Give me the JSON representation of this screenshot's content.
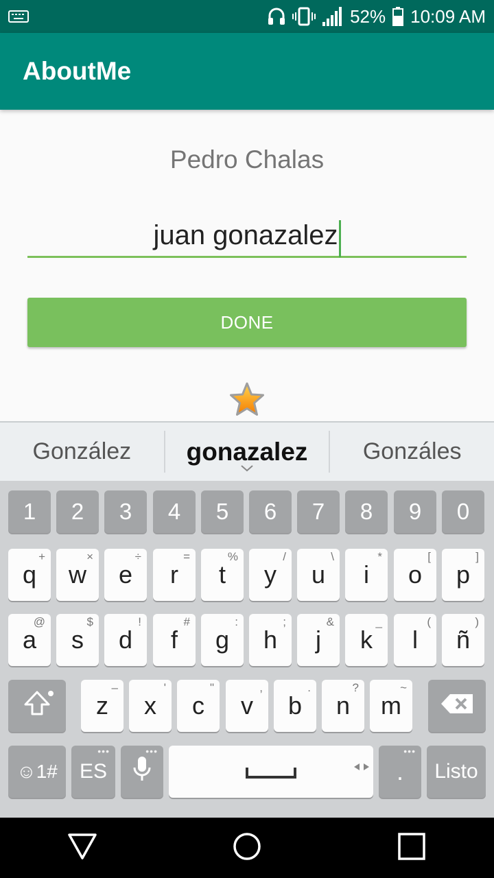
{
  "status_bar": {
    "battery": "52%",
    "time": "10:09 AM"
  },
  "app": {
    "title": "AboutMe"
  },
  "content": {
    "name_text": "Pedro Chalas",
    "nickname_input_value": "juan gonazalez",
    "done_label": "DONE"
  },
  "suggestions": [
    "González",
    "gonazalez",
    "Gonzáles"
  ],
  "keyboard": {
    "numbers": [
      "1",
      "2",
      "3",
      "4",
      "5",
      "6",
      "7",
      "8",
      "9",
      "0"
    ],
    "row1": [
      {
        "k": "q",
        "s": "+"
      },
      {
        "k": "w",
        "s": "×"
      },
      {
        "k": "e",
        "s": "÷"
      },
      {
        "k": "r",
        "s": "="
      },
      {
        "k": "t",
        "s": "%"
      },
      {
        "k": "y",
        "s": "/"
      },
      {
        "k": "u",
        "s": "\\"
      },
      {
        "k": "i",
        "s": "*"
      },
      {
        "k": "o",
        "s": "["
      },
      {
        "k": "p",
        "s": "]"
      }
    ],
    "row2": [
      {
        "k": "a",
        "s": "@"
      },
      {
        "k": "s",
        "s": "$"
      },
      {
        "k": "d",
        "s": "!"
      },
      {
        "k": "f",
        "s": "#"
      },
      {
        "k": "g",
        "s": ":"
      },
      {
        "k": "h",
        "s": ";"
      },
      {
        "k": "j",
        "s": "&"
      },
      {
        "k": "k",
        "s": "_"
      },
      {
        "k": "l",
        "s": "("
      },
      {
        "k": "ñ",
        "s": ")"
      }
    ],
    "row3": [
      {
        "k": "z",
        "s": "–"
      },
      {
        "k": "x",
        "s": "'"
      },
      {
        "k": "c",
        "s": "\""
      },
      {
        "k": "v",
        "s": ","
      },
      {
        "k": "b",
        "s": "."
      },
      {
        "k": "n",
        "s": "?"
      },
      {
        "k": "m",
        "s": "~"
      }
    ],
    "symbols_label": "☺1#",
    "language_label": "ES",
    "period_label": ".",
    "enter_label": "Listo"
  }
}
